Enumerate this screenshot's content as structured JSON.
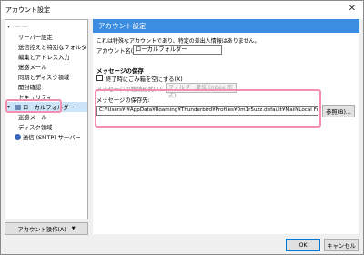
{
  "window": {
    "title": "アカウント設定",
    "close": "✕"
  },
  "tree": {
    "root_expander": "▾",
    "root_label": "— —",
    "items": [
      {
        "label": "サーバー設定"
      },
      {
        "label": "送信控えと特別なフォルダー"
      },
      {
        "label": "編集とアドレス入力"
      },
      {
        "label": "迷惑メール"
      },
      {
        "label": "同期とディスク領域"
      },
      {
        "label": "開封確認"
      },
      {
        "label": "セキュリティ"
      },
      {
        "label": "ローカルフォルダー",
        "selected": true
      },
      {
        "label": "迷惑メール"
      },
      {
        "label": "ディスク領域"
      },
      {
        "label": "送信 (SMTP) サーバー"
      }
    ],
    "local_expander": "▾"
  },
  "account_actions": {
    "label": "アカウント操作(A)",
    "arrow": "▼"
  },
  "panel": {
    "header": "アカウント設定",
    "info_text": "これは特殊なアカウントであり、特定の差出人情報はありません。",
    "account_name_label": "アカウント名(N):",
    "account_name_value": "ローカルフォルダー",
    "message_storage_title": "メッセージの保存",
    "empty_trash_label": "終了時にごみ箱を空にする(X)",
    "storage_type_label": "メッセージの格納形式(T):",
    "storage_type_value": "フォルダー単位 (mbox 形式)",
    "storage_dir_label": "メッセージの保存先:",
    "storage_dir_value": "C:¥Users¥        ¥AppData¥Roaming¥Thunderbird¥Profiles¥0m1r5uzz.default¥Mail¥Local Folders",
    "browse_label": "参照(B)..."
  },
  "footer": {
    "ok_label": "OK",
    "cancel_label": "キャンセル"
  }
}
